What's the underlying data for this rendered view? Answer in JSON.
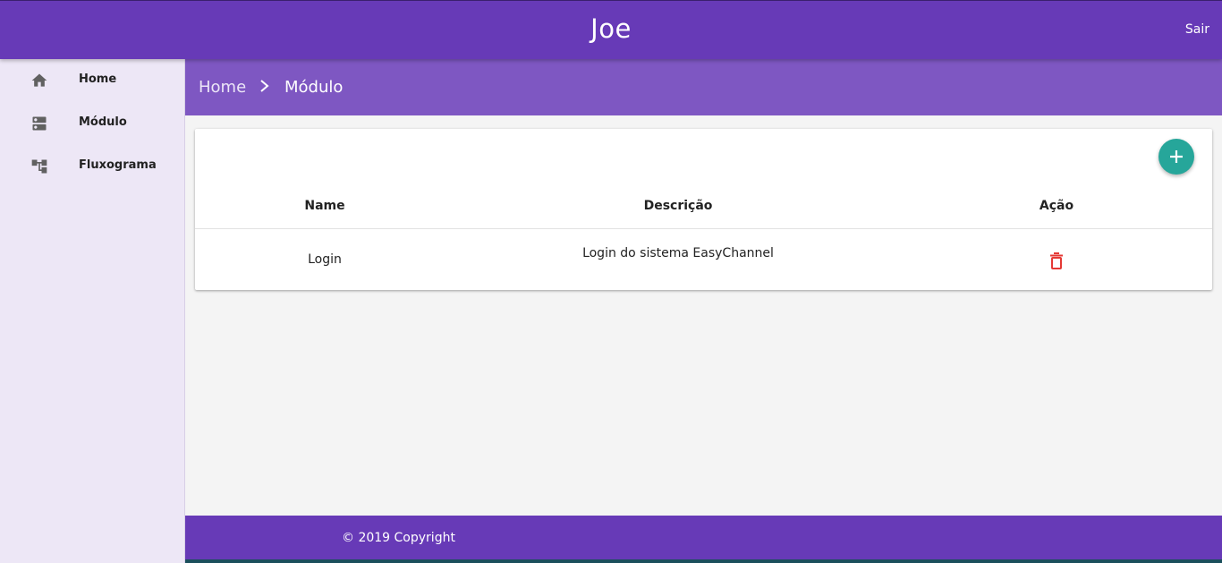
{
  "header": {
    "title": "Joe",
    "logout_label": "Sair"
  },
  "sidebar": {
    "items": [
      {
        "label": "Home",
        "icon": "home-icon"
      },
      {
        "label": "Módulo",
        "icon": "dns-icon"
      },
      {
        "label": "Fluxograma",
        "icon": "account-tree-icon"
      }
    ]
  },
  "breadcrumb": {
    "home": "Home",
    "separator_icon": "chevron-right-icon",
    "current": "Módulo"
  },
  "table": {
    "add_button_icon": "add-icon",
    "columns": [
      "Name",
      "Descrição",
      "Ação"
    ],
    "rows": [
      {
        "name": "Login",
        "description": "Login do sistema EasyChannel",
        "action_icon": "delete-icon"
      }
    ]
  },
  "footer": {
    "copyright": "© 2019 Copyright"
  },
  "colors": {
    "primary": "#673ab7",
    "primary_light": "#7e57c2",
    "sidebar_bg": "#ede7f6",
    "fab": "#26a69a",
    "delete": "#e53935"
  }
}
